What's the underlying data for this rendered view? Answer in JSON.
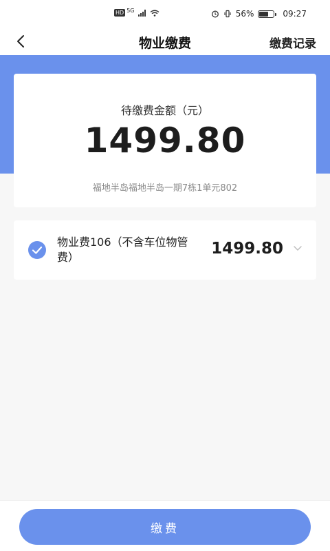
{
  "status_bar": {
    "network_badge": "HD",
    "network_type": "5G",
    "battery_text": "56%",
    "time": "09:27"
  },
  "nav": {
    "title": "物业缴费",
    "action_label": "缴费记录",
    "back_icon": "chevron-left-icon"
  },
  "summary": {
    "label": "待缴费金额（元）",
    "amount": "1499.80",
    "address": "福地半岛福地半岛一期7栋1单元802"
  },
  "fee_items": [
    {
      "name": "物业费106（不含车位物管费）",
      "amount": "1499.80",
      "checked": true
    }
  ],
  "footer": {
    "pay_label": "缴费"
  },
  "colors": {
    "accent": "#6a91ec",
    "background": "#f7f7f7",
    "card": "#ffffff"
  }
}
